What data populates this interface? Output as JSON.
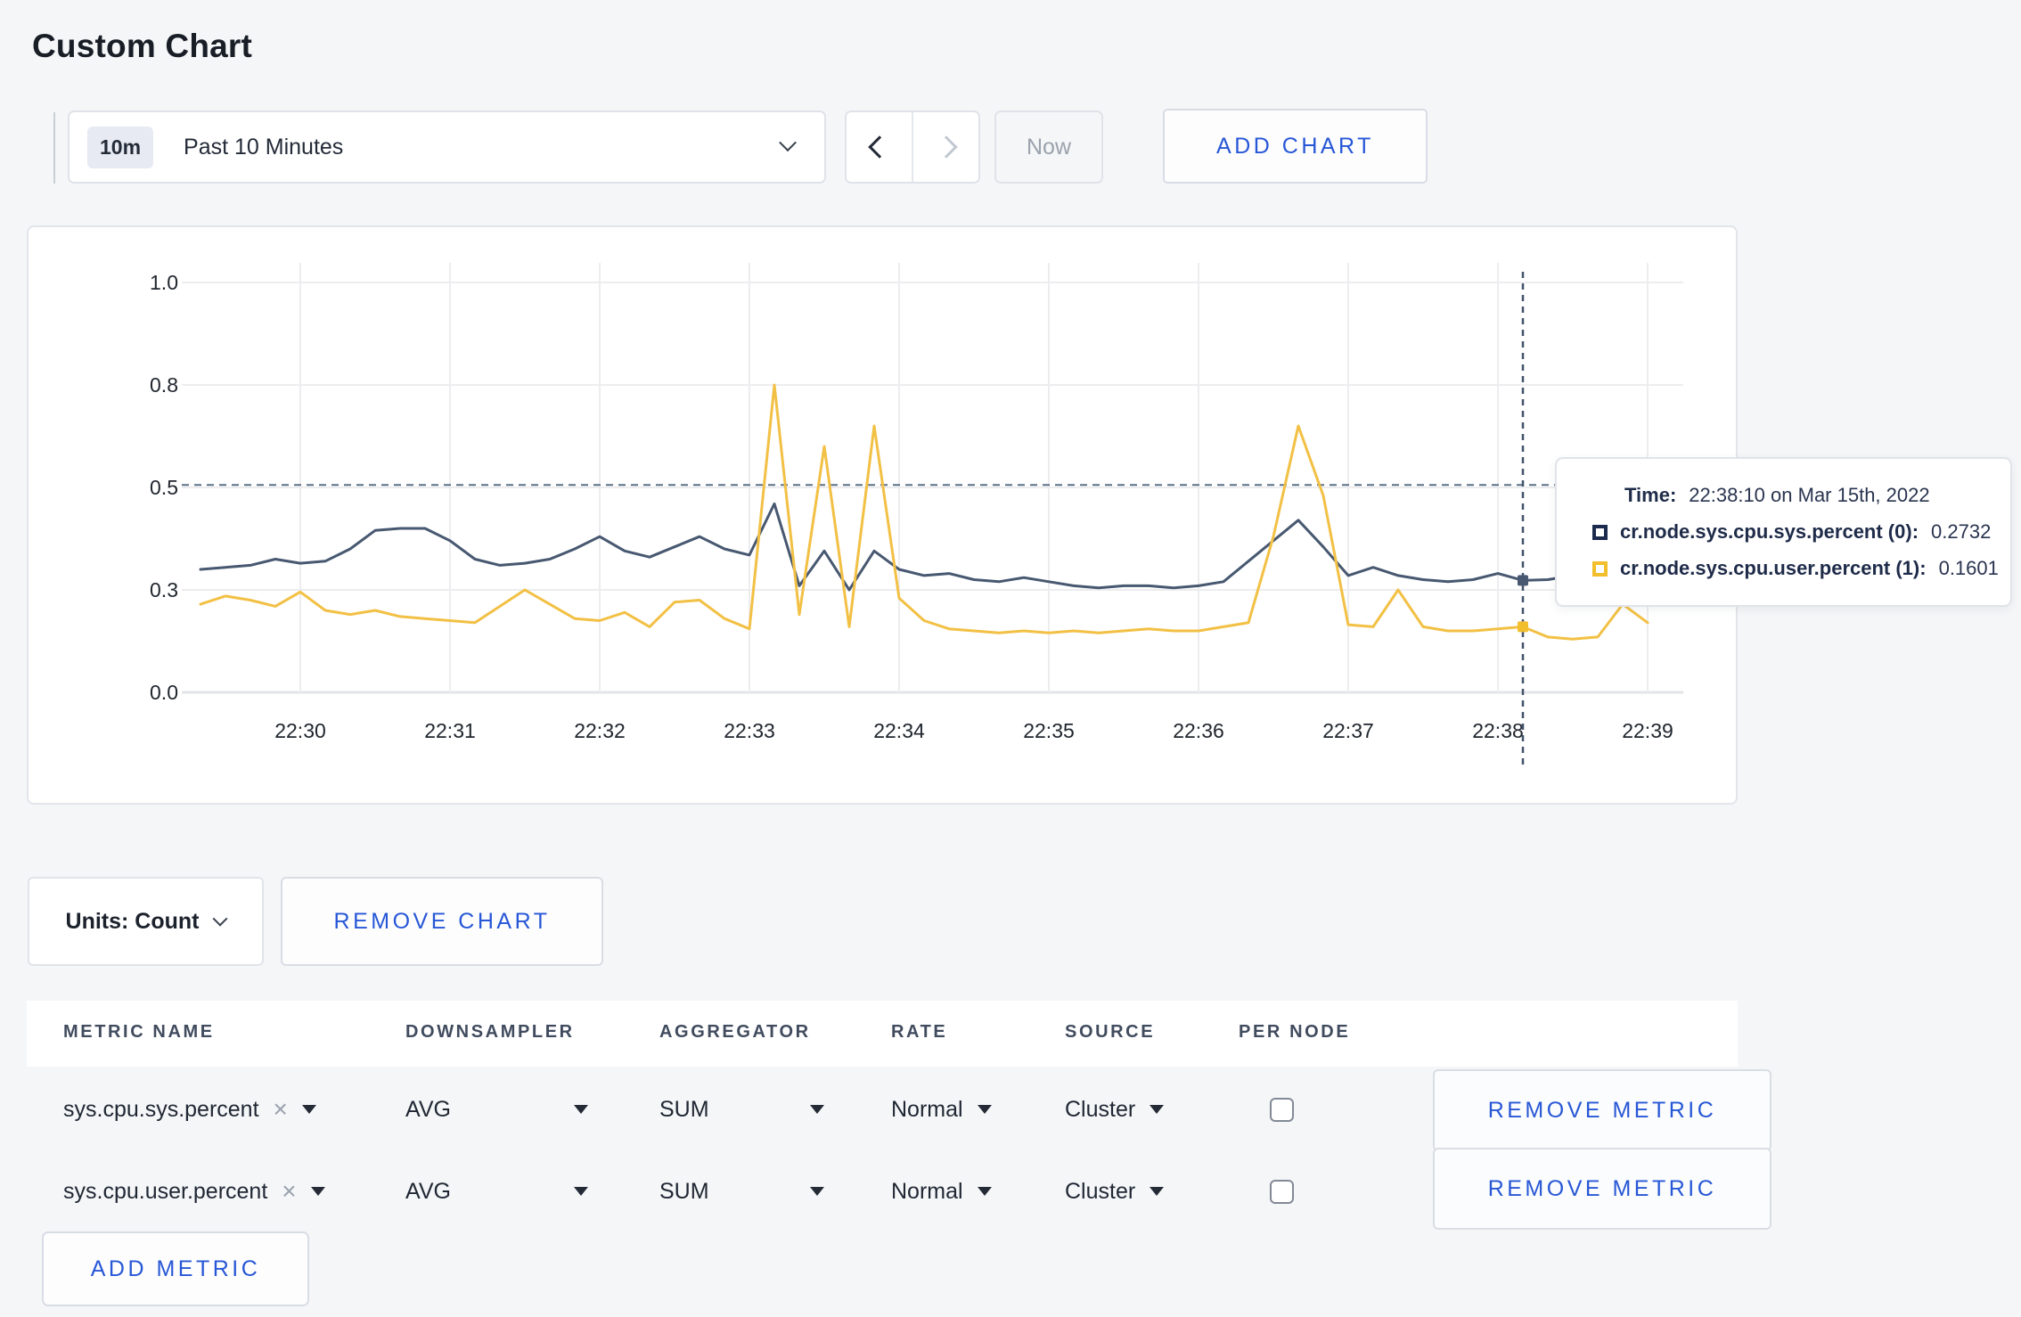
{
  "page": {
    "title": "Custom Chart",
    "background": "#f5f6f8"
  },
  "icons": {
    "close": "×"
  },
  "toolbar": {
    "time_window_badge": "10m",
    "time_window_label": "Past 10 Minutes",
    "now_label": "Now",
    "add_chart_label": "ADD CHART"
  },
  "colors": {
    "accent_blue": "#2757d6",
    "series_sys": "#475870",
    "series_user": "#f2c044",
    "tooltip_sys_swatch": "#1b2b4e",
    "tooltip_user_swatch": "#f2be2c",
    "gridline": "#ededf0",
    "crosshair": "#42526b"
  },
  "chart_data": {
    "type": "line",
    "title": "",
    "xlabel": "",
    "ylabel": "",
    "ylim": [
      0,
      1
    ],
    "grid": true,
    "y_ticks": [
      {
        "label": "0.0",
        "value": 0
      },
      {
        "label": "0.3",
        "value": 0.25
      },
      {
        "label": "0.5",
        "value": 0.5
      },
      {
        "label": "0.8",
        "value": 0.75
      },
      {
        "label": "1.0",
        "value": 1
      }
    ],
    "x_tick_labels": [
      "22:30",
      "22:31",
      "22:32",
      "22:33",
      "22:34",
      "22:35",
      "22:36",
      "22:37",
      "22:38",
      "22:39"
    ],
    "x": [
      "22:29:20",
      "22:29:30",
      "22:29:40",
      "22:29:50",
      "22:30:00",
      "22:30:10",
      "22:30:20",
      "22:30:30",
      "22:30:40",
      "22:30:50",
      "22:31:00",
      "22:31:10",
      "22:31:20",
      "22:31:30",
      "22:31:40",
      "22:31:50",
      "22:32:00",
      "22:32:10",
      "22:32:20",
      "22:32:30",
      "22:32:40",
      "22:32:50",
      "22:33:00",
      "22:33:10",
      "22:33:20",
      "22:33:30",
      "22:33:40",
      "22:33:50",
      "22:34:00",
      "22:34:10",
      "22:34:20",
      "22:34:30",
      "22:34:40",
      "22:34:50",
      "22:35:00",
      "22:35:10",
      "22:35:20",
      "22:35:30",
      "22:35:40",
      "22:35:50",
      "22:36:00",
      "22:36:10",
      "22:36:20",
      "22:36:30",
      "22:36:40",
      "22:36:50",
      "22:37:00",
      "22:37:10",
      "22:37:20",
      "22:37:30",
      "22:37:40",
      "22:37:50",
      "22:38:00",
      "22:38:10",
      "22:38:20",
      "22:38:30",
      "22:38:40",
      "22:38:50",
      "22:39:00"
    ],
    "series": [
      {
        "name": "cr.node.sys.cpu.sys.percent",
        "color": "#475870",
        "values": [
          0.3,
          0.305,
          0.31,
          0.325,
          0.315,
          0.32,
          0.35,
          0.395,
          0.4,
          0.4,
          0.37,
          0.325,
          0.31,
          0.315,
          0.325,
          0.35,
          0.38,
          0.345,
          0.33,
          0.355,
          0.38,
          0.35,
          0.335,
          0.46,
          0.26,
          0.345,
          0.25,
          0.345,
          0.3,
          0.285,
          0.29,
          0.275,
          0.27,
          0.28,
          0.27,
          0.26,
          0.255,
          0.26,
          0.26,
          0.255,
          0.26,
          0.27,
          0.32,
          0.37,
          0.42,
          0.355,
          0.285,
          0.305,
          0.285,
          0.275,
          0.27,
          0.275,
          0.29,
          0.2732,
          0.275,
          0.285,
          0.27,
          0.285,
          0.28
        ]
      },
      {
        "name": "cr.node.sys.cpu.user.percent",
        "color": "#f2c044",
        "values": [
          0.215,
          0.235,
          0.225,
          0.21,
          0.245,
          0.2,
          0.19,
          0.2,
          0.185,
          0.18,
          0.175,
          0.17,
          0.21,
          0.25,
          0.215,
          0.18,
          0.175,
          0.195,
          0.16,
          0.22,
          0.225,
          0.18,
          0.155,
          0.75,
          0.19,
          0.6,
          0.16,
          0.65,
          0.23,
          0.175,
          0.155,
          0.15,
          0.145,
          0.15,
          0.145,
          0.15,
          0.145,
          0.15,
          0.155,
          0.15,
          0.15,
          0.16,
          0.17,
          0.38,
          0.65,
          0.48,
          0.165,
          0.16,
          0.25,
          0.16,
          0.15,
          0.15,
          0.155,
          0.1601,
          0.135,
          0.13,
          0.135,
          0.215,
          0.17
        ]
      }
    ],
    "crosshair": {
      "x_index": 53,
      "time": "22:38:10",
      "horizontal_value": 0.506,
      "markers": [
        {
          "series": 0,
          "value": 0.2732,
          "color": "#475870"
        },
        {
          "series": 1,
          "value": 0.1601,
          "color": "#f2be2c"
        }
      ]
    },
    "legend_position": "tooltip"
  },
  "tooltip": {
    "time_label": "Time:",
    "time_value": "22:38:10 on Mar 15th, 2022",
    "series": [
      {
        "name": "cr.node.sys.cpu.sys.percent (0):",
        "value": "0.2732",
        "swatch": "#1b2b4e"
      },
      {
        "name": "cr.node.sys.cpu.user.percent (1):",
        "value": "0.1601",
        "swatch": "#f2be2c"
      }
    ]
  },
  "chart_controls": {
    "units_label": "Units: Count",
    "remove_chart_label": "REMOVE CHART"
  },
  "metrics_table": {
    "headers": [
      "METRIC NAME",
      "DOWNSAMPLER",
      "AGGREGATOR",
      "RATE",
      "SOURCE",
      "PER NODE"
    ],
    "rows": [
      {
        "metric": "sys.cpu.sys.percent",
        "downsampler": "AVG",
        "aggregator": "SUM",
        "rate": "Normal",
        "source": "Cluster",
        "per_node": false,
        "remove_label": "REMOVE METRIC"
      },
      {
        "metric": "sys.cpu.user.percent",
        "downsampler": "AVG",
        "aggregator": "SUM",
        "rate": "Normal",
        "source": "Cluster",
        "per_node": false,
        "remove_label": "REMOVE METRIC"
      }
    ],
    "add_metric_label": "ADD METRIC"
  }
}
